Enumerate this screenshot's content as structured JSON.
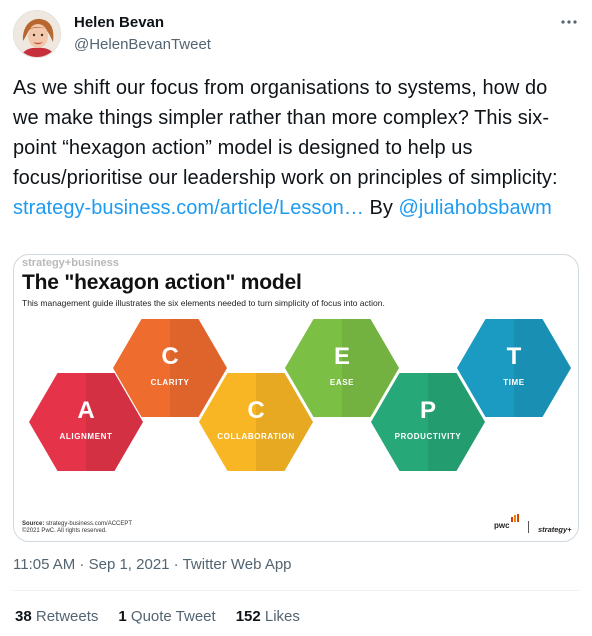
{
  "author": {
    "name": "Helen Bevan",
    "handle": "@HelenBevanTweet"
  },
  "tweet": {
    "text": "As we shift our focus from organisations to systems, how do we make things simpler rather than more complex? This six-point “hexagon action” model is designed to help us focus/prioritise our leadership work on principles of simplicity: ",
    "link": "strategy-business.com/article/Lesson…",
    "by": " By ",
    "mention": "@juliahobsbawm"
  },
  "card": {
    "brand": "strategy+business",
    "title": "The \"hexagon action\" model",
    "subtitle": "This management guide illustrates the six elements needed to turn simplicity of focus into action.",
    "source_label": "Source:",
    "source_text": " strategy-business.com/ACCEPT",
    "copyright": "©2021 PwC. All rights reserved.",
    "logo_pwc": "pwc",
    "logo_sb": "strategy+",
    "hexagons": [
      {
        "letter": "A",
        "word": "ALIGNMENT",
        "color": "#e5344a"
      },
      {
        "letter": "C",
        "word": "CLARITY",
        "color": "#ef6c2f"
      },
      {
        "letter": "C",
        "word": "COLLABORATION",
        "color": "#f8b624"
      },
      {
        "letter": "E",
        "word": "EASE",
        "color": "#7cbf45"
      },
      {
        "letter": "P",
        "word": "PRODUCTIVITY",
        "color": "#26a879"
      },
      {
        "letter": "T",
        "word": "TIME",
        "color": "#1b9bc1"
      }
    ]
  },
  "meta": {
    "time": "11:05 AM",
    "sep": " · ",
    "date": "Sep 1, 2021",
    "source": "Twitter Web App"
  },
  "stats": {
    "retweets_count": "38",
    "retweets_label": " Retweets",
    "quotes_count": "1",
    "quotes_label": " Quote Tweet",
    "likes_count": "152",
    "likes_label": " Likes"
  },
  "icons": {
    "more": "more-horizontal-icon"
  }
}
